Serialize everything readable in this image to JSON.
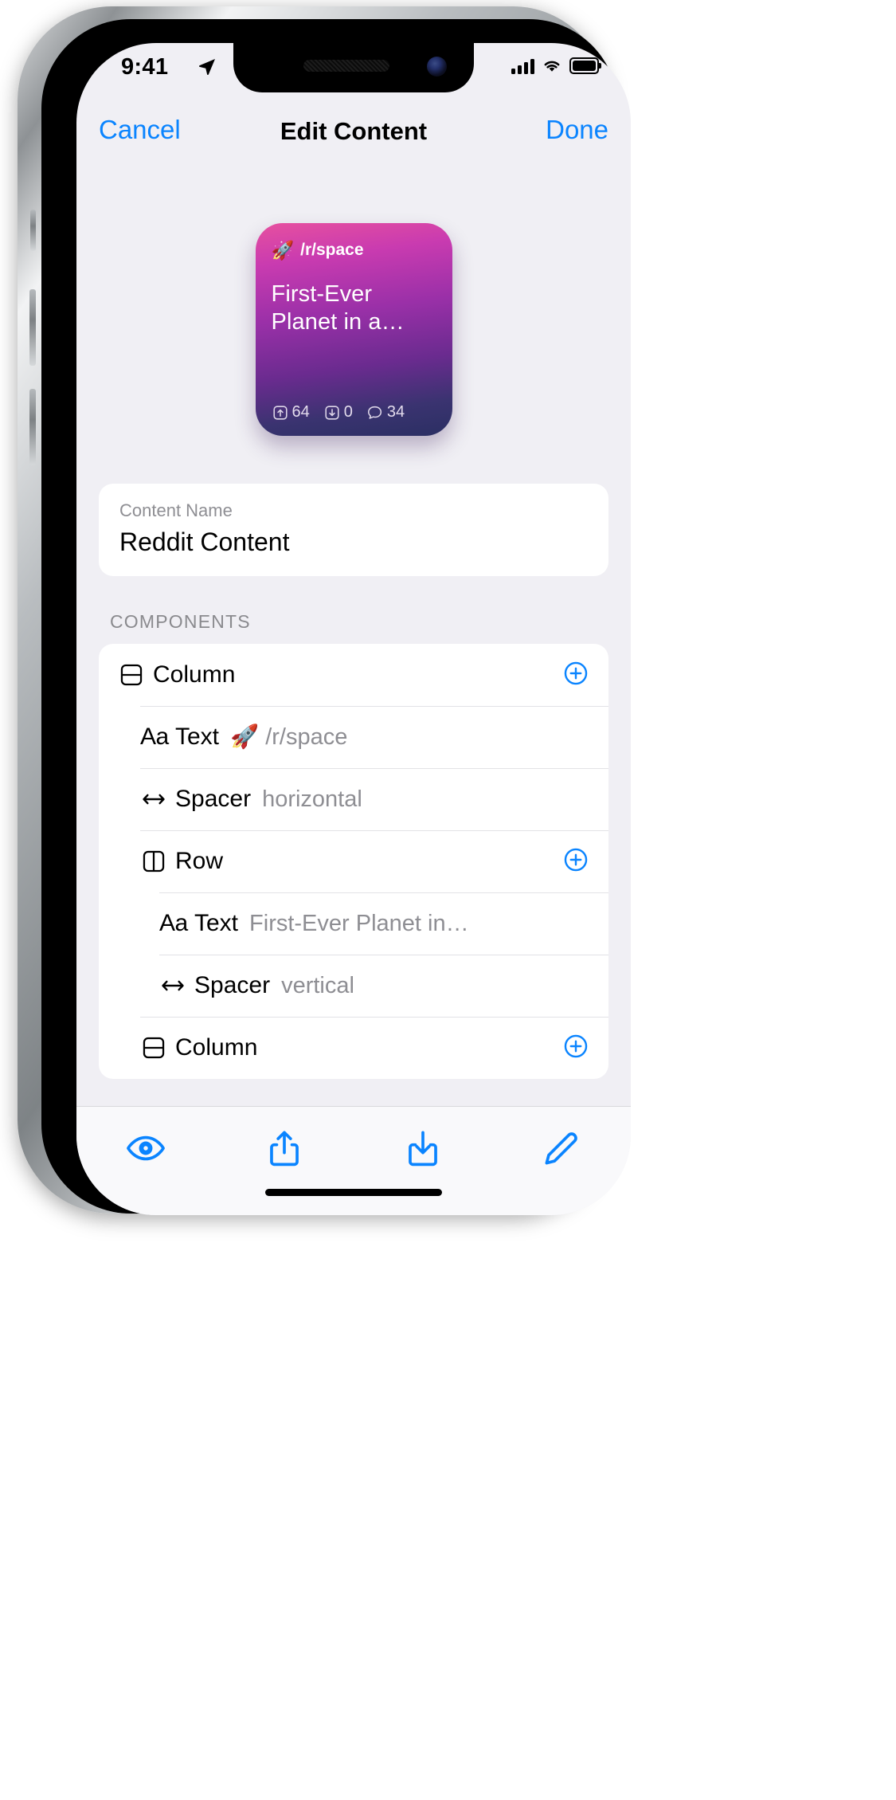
{
  "status_bar": {
    "time": "9:41",
    "location_icon": "location-arrow-icon",
    "cellular_icon": "cellular-bars-icon",
    "wifi_icon": "wifi-icon",
    "battery_icon": "battery-full-icon"
  },
  "nav": {
    "cancel_label": "Cancel",
    "title": "Edit Content",
    "done_label": "Done"
  },
  "preview_card": {
    "subreddit_emoji": "🚀",
    "subreddit": "/r/space",
    "title": "First-Ever Planet in a…",
    "upvotes": "64",
    "downvotes": "0",
    "comments": "34",
    "gradient_top": "#e7509f",
    "gradient_bottom": "#2b2f63"
  },
  "content_name_field": {
    "label": "Content Name",
    "value": "Reddit Content",
    "placeholder": "Content Name"
  },
  "components_section": {
    "header": "COMPONENTS",
    "rows": [
      {
        "icon": "column-icon",
        "label": "Column",
        "value": "",
        "indent": 0,
        "has_add": true
      },
      {
        "icon": "text-aa-icon",
        "label": "Text",
        "value": "🚀 /r/space",
        "indent": 1,
        "has_add": false
      },
      {
        "icon": "spacer-arrows-icon",
        "label": "Spacer",
        "value": "horizontal",
        "indent": 1,
        "has_add": false
      },
      {
        "icon": "row-icon",
        "label": "Row",
        "value": "",
        "indent": 1,
        "has_add": true
      },
      {
        "icon": "text-aa-icon",
        "label": "Text",
        "value": "First-Ever Planet in…",
        "indent": 2,
        "has_add": false
      },
      {
        "icon": "spacer-arrows-icon",
        "label": "Spacer",
        "value": "vertical",
        "indent": 2,
        "has_add": false
      },
      {
        "icon": "column-icon",
        "label": "Column",
        "value": "",
        "indent": 1,
        "has_add": true
      }
    ],
    "add_button_icon": "plus-circle-icon",
    "accent_color": "#0a84ff"
  },
  "toolbar": {
    "items": [
      {
        "icon": "eye-preview-icon",
        "name": "preview-button"
      },
      {
        "icon": "share-export-icon",
        "name": "share-button"
      },
      {
        "icon": "download-import-icon",
        "name": "import-button"
      },
      {
        "icon": "pencil-edit-icon",
        "name": "edit-button"
      }
    ],
    "accent_color": "#0a84ff"
  }
}
